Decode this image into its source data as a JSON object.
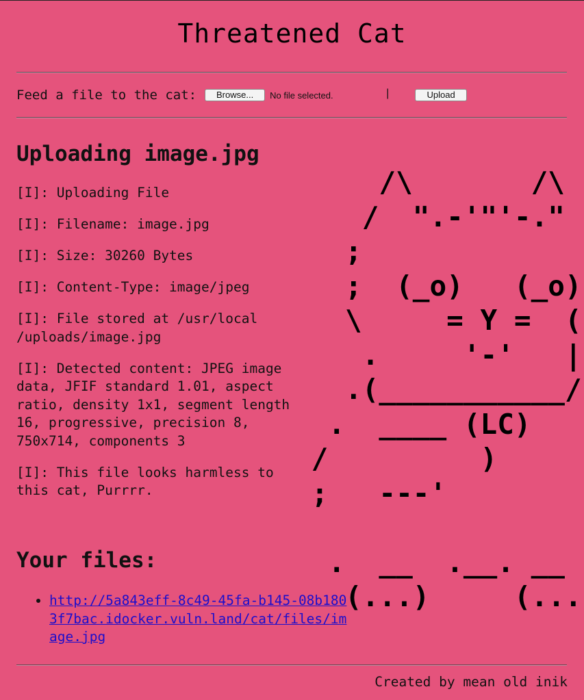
{
  "header": {
    "title": "Threatened Cat"
  },
  "upload_form": {
    "prompt": "Feed a file to the cat:",
    "browse_label": "Browse...",
    "file_status": "No file selected.",
    "upload_label": "Upload"
  },
  "result": {
    "heading": "Uploading image.jpg",
    "log": [
      "[I]: Uploading File",
      "[I]: Filename: image.jpg",
      "[I]: Size: 30260 Bytes",
      "[I]: Content-Type: image/jpeg",
      "[I]: File stored at /usr/local /uploads/image.jpg",
      "[I]: Detected content: JPEG image data, JFIF standard 1.01, aspect ratio, density 1x1, segment length 16, progressive, precision 8, 750x714, components 3",
      "[I]: This file looks harmless to this cat, Purrrr."
    ]
  },
  "cat_art": [
    "     /\\       /\\",
    "    /  \".-'\"'-.\"",
    "   ;",
    "   ;  (_o)   (_o)",
    "   \\     = Y =  (",
    "    .     '-'   |",
    "   .(___________/",
    "  .  ____ (LC)   .",
    " /         )",
    " ;   ---'",
    "",
    "  .  __  .__. __",
    "   (...)     (..."
  ],
  "files": {
    "heading": "Your files:",
    "links": [
      "http://5a843eff-8c49-45fa-b145-08b1803f7bac.idocker.vuln.land/cat/files/image.jpg"
    ]
  },
  "footer": {
    "credit": "Created by mean old inik"
  }
}
